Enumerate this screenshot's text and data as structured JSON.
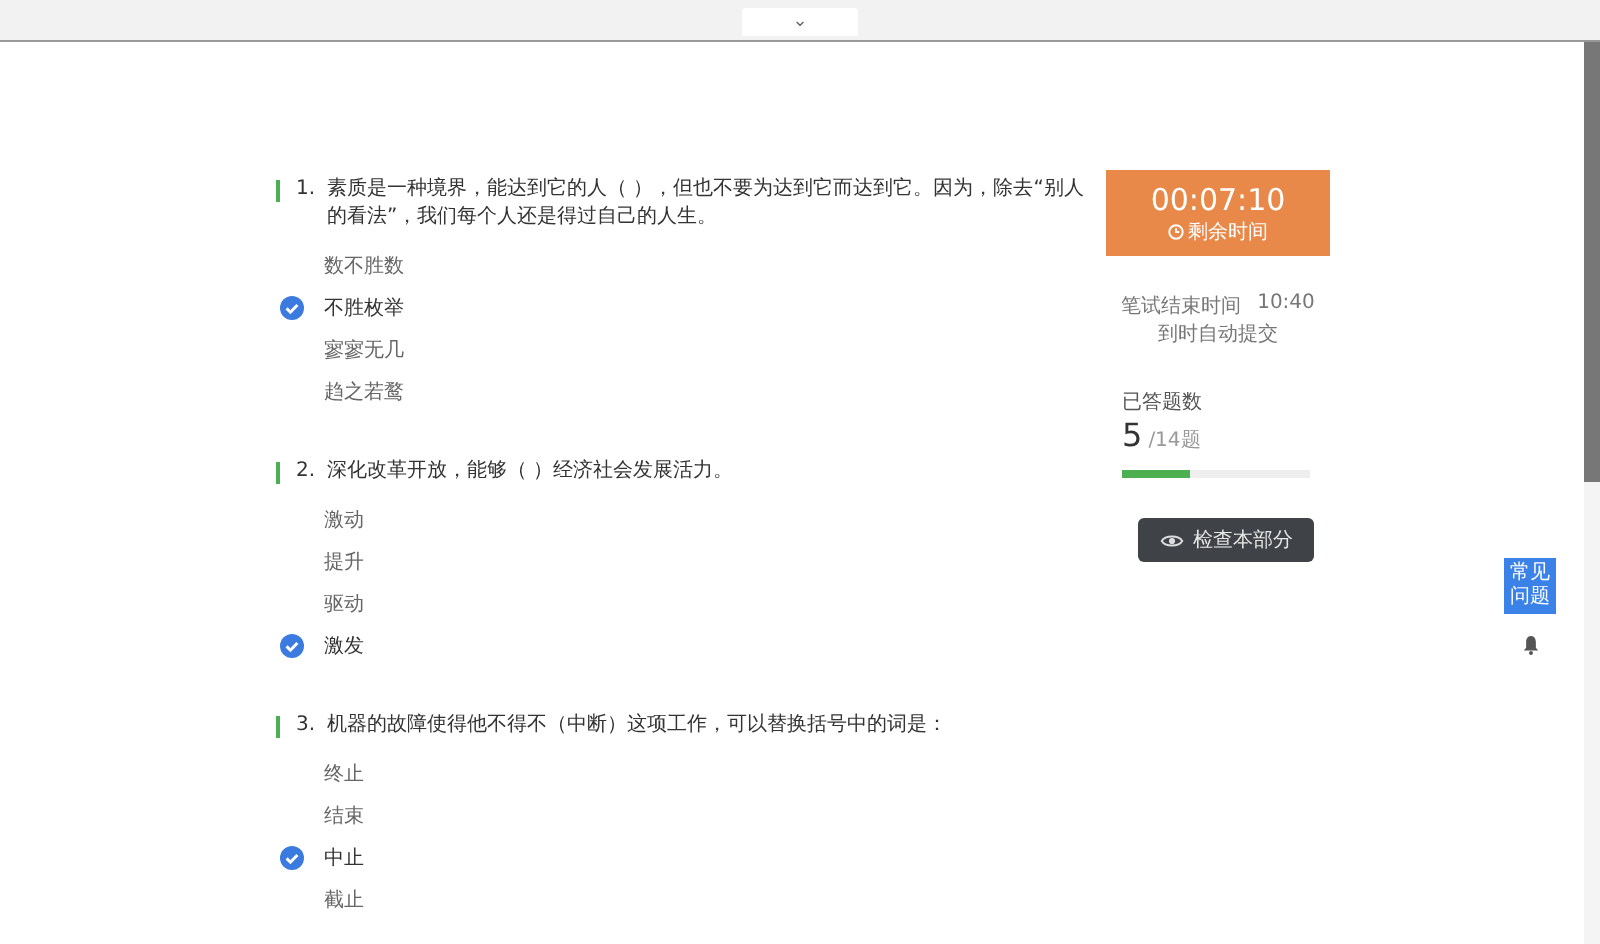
{
  "top_bar": {
    "collapse_icon": "⌄"
  },
  "questions": [
    {
      "number": "1.",
      "text": "素质是一种境界，能达到它的人（ ），但也不要为达到它而达到它。因为，除去“别人的看法”，我们每个人还是得过自己的人生。",
      "options": [
        {
          "label": "数不胜数",
          "selected": false
        },
        {
          "label": "不胜枚举",
          "selected": true
        },
        {
          "label": "寥寥无几",
          "selected": false
        },
        {
          "label": "趋之若鹜",
          "selected": false
        }
      ]
    },
    {
      "number": "2.",
      "text": "深化改革开放，能够（ ）经济社会发展活力。",
      "options": [
        {
          "label": "激动",
          "selected": false
        },
        {
          "label": "提升",
          "selected": false
        },
        {
          "label": "驱动",
          "selected": false
        },
        {
          "label": "激发",
          "selected": true
        }
      ]
    },
    {
      "number": "3.",
      "text": "机器的故障使得他不得不（中断）这项工作，可以替换括号中的词是：",
      "options": [
        {
          "label": "终止",
          "selected": false
        },
        {
          "label": "结束",
          "selected": false
        },
        {
          "label": "中止",
          "selected": true
        },
        {
          "label": "截止",
          "selected": false
        }
      ]
    }
  ],
  "sidebar": {
    "timer": "00:07:10",
    "timer_label": "剩余时间",
    "end_time_label": "笔试结束时间",
    "end_time": "10:40",
    "auto_submit": "到时自动提交",
    "progress_label": "已答题数",
    "answered": "5",
    "total": "/14题",
    "level": 0.36,
    "check_button": "检查本部分"
  },
  "help_button": "常见问题"
}
